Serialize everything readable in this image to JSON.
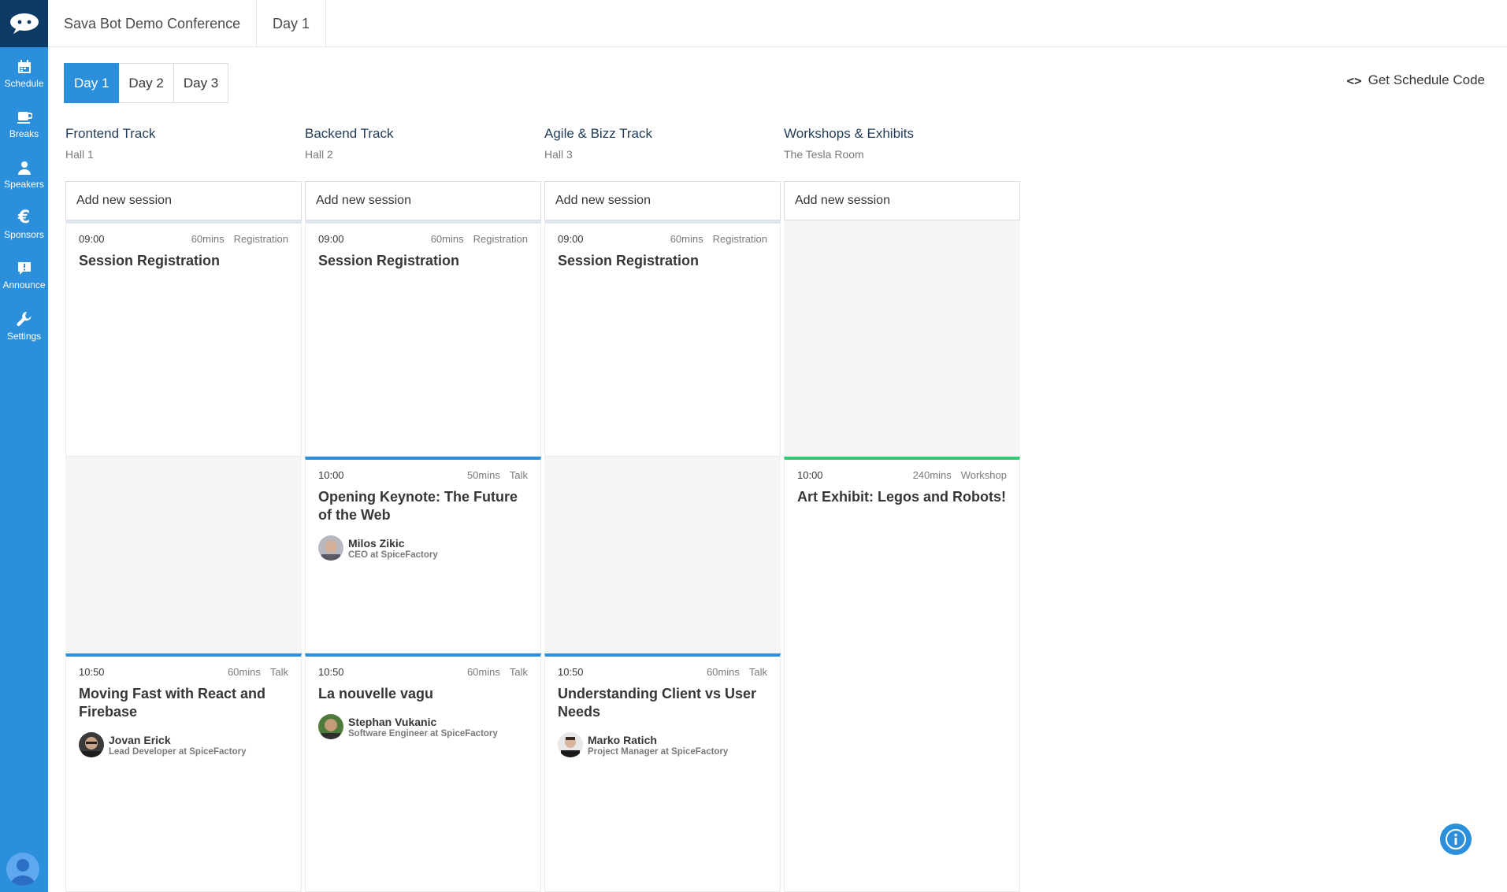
{
  "sidebar": {
    "logo": "sava-bot-logo",
    "items": [
      {
        "label": "Schedule",
        "icon": "calendar-icon"
      },
      {
        "label": "Breaks",
        "icon": "coffee-icon"
      },
      {
        "label": "Speakers",
        "icon": "person-icon"
      },
      {
        "label": "Sponsors",
        "icon": "euro-icon"
      },
      {
        "label": "Announce",
        "icon": "announce-icon"
      },
      {
        "label": "Settings",
        "icon": "wrench-icon"
      }
    ]
  },
  "topbar": {
    "conference": "Sava Bot Demo Conference",
    "day": "Day 1"
  },
  "day_tabs": [
    "Day 1",
    "Day 2",
    "Day 3"
  ],
  "active_day": "Day 1",
  "get_code": {
    "icon": "<>",
    "label": "Get Schedule Code"
  },
  "add_label": "Add new session",
  "tracks": [
    {
      "name": "Frontend Track",
      "hall": "Hall 1"
    },
    {
      "name": "Backend Track",
      "hall": "Hall 2"
    },
    {
      "name": "Agile & Bizz Track",
      "hall": "Hall 3"
    },
    {
      "name": "Workshops & Exhibits",
      "hall": "The Tesla Room"
    }
  ],
  "sessions": {
    "frontend": [
      {
        "time": "09:00",
        "duration": "60mins",
        "type": "Registration",
        "title": "Session Registration"
      },
      {
        "time": "10:50",
        "duration": "60mins",
        "type": "Talk",
        "title": "Moving Fast with React and Firebase",
        "speaker": {
          "name": "Jovan Erick",
          "role": "Lead Developer at SpiceFactory"
        }
      }
    ],
    "backend": [
      {
        "time": "09:00",
        "duration": "60mins",
        "type": "Registration",
        "title": "Session Registration"
      },
      {
        "time": "10:00",
        "duration": "50mins",
        "type": "Talk",
        "title": "Opening Keynote: The Future of the Web",
        "speaker": {
          "name": "Milos Zikic",
          "role": "CEO at SpiceFactory"
        }
      },
      {
        "time": "10:50",
        "duration": "60mins",
        "type": "Talk",
        "title": "La nouvelle vagu",
        "speaker": {
          "name": "Stephan Vukanic",
          "role": "Software Engineer at SpiceFactory"
        }
      }
    ],
    "agile": [
      {
        "time": "09:00",
        "duration": "60mins",
        "type": "Registration",
        "title": "Session Registration"
      },
      {
        "time": "10:50",
        "duration": "60mins",
        "type": "Talk",
        "title": "Understanding Client vs User Needs",
        "speaker": {
          "name": "Marko Ratich",
          "role": "Project Manager at SpiceFactory"
        }
      }
    ],
    "workshops": [
      {
        "time": "10:00",
        "duration": "240mins",
        "type": "Workshop",
        "title": "Art Exhibit: Legos and Robots!"
      }
    ]
  },
  "colors": {
    "primary": "#2b8fdc",
    "sidebar": "#2b8fdc",
    "logo_bg": "#0d3b66",
    "workshop": "#2ecc71"
  }
}
